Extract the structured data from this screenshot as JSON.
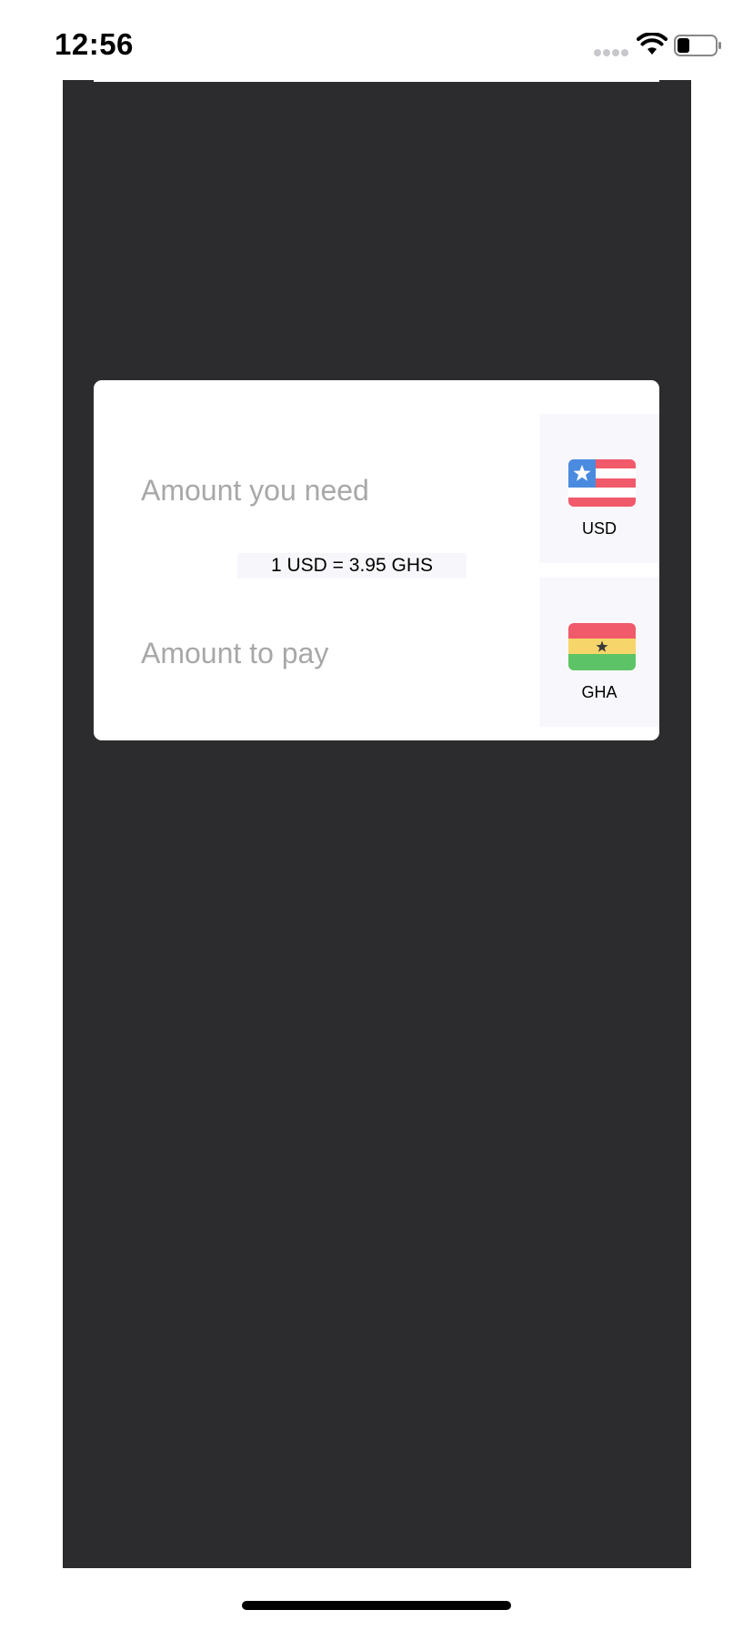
{
  "status_bar": {
    "time": "12:56"
  },
  "converter": {
    "amount_need_placeholder": "Amount you need",
    "amount_pay_placeholder": "Amount to pay",
    "rate_text": "1 USD = 3.95 GHS",
    "from_currency": {
      "code": "USD",
      "flag_icon": "us-flag-icon"
    },
    "to_currency": {
      "code": "GHA",
      "flag_icon": "ghana-flag-icon"
    }
  },
  "colors": {
    "backdrop": "#2c2c2e",
    "card": "#ffffff",
    "placeholder_text": "#a8a8a8",
    "flag_red": "#f05a6b",
    "flag_blue": "#4a8be0",
    "flag_yellow": "#f6d66a",
    "flag_green": "#5cc466"
  }
}
